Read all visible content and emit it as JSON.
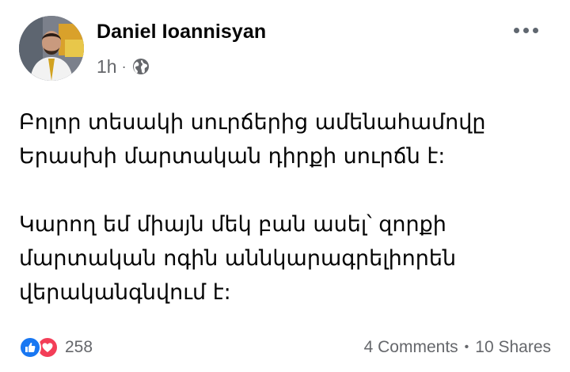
{
  "post": {
    "author": "Daniel Ioannisyan",
    "time": "1h",
    "separator": "·",
    "privacy_icon": "globe-icon",
    "more_icon": "more-horizontal-icon",
    "paragraphs": [
      [
        "Բոլոր տեսակի սուրճերից ամենահամովը",
        "Երասխի մարտական դիրքի սուրճն է:"
      ],
      [
        "Կարող եմ միայն մեկ բան ասել՝ զորքի",
        "մարտական ոգին աննկարագրելիորեն",
        "վերականգնվում է:"
      ]
    ]
  },
  "footer": {
    "reactions": [
      "like-icon",
      "love-icon"
    ],
    "reaction_count": "258",
    "comments": "4 Comments",
    "shares": "10 Shares",
    "dot": "•"
  },
  "colors": {
    "like": "#1877f2",
    "love": "#f33e58",
    "secondary_text": "#65676b"
  }
}
